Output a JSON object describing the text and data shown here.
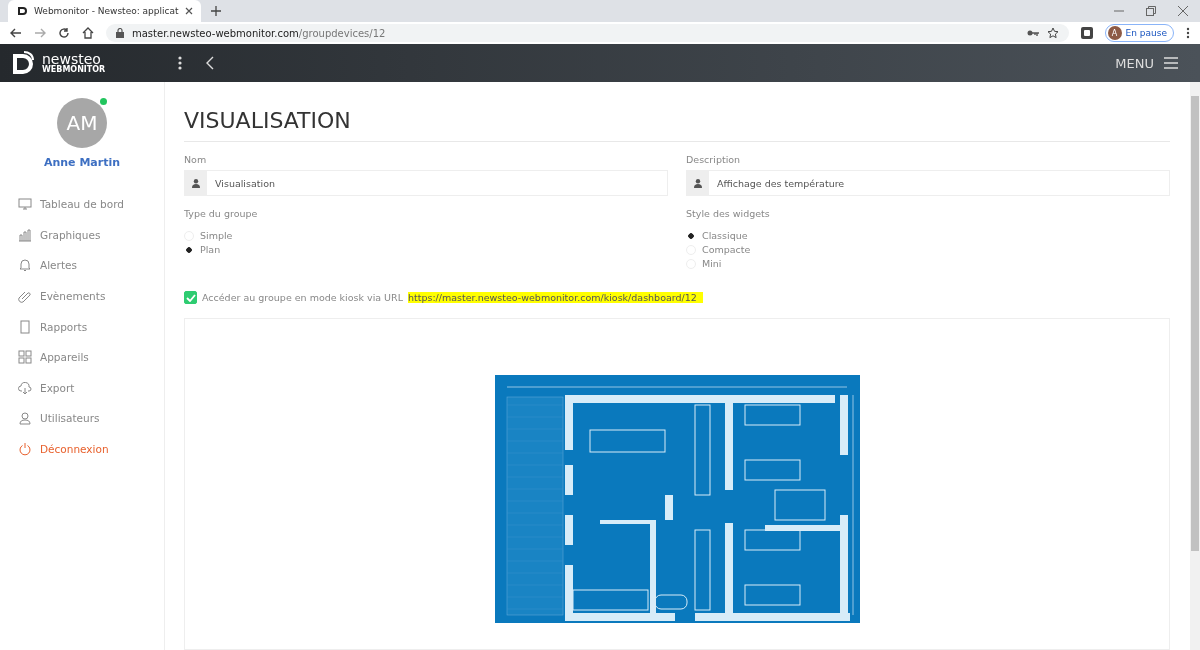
{
  "browser": {
    "tab_title": "Webmonitor - Newsteo: applicat",
    "address_host": "master.newsteo-webmonitor.com",
    "address_path": "/groupdevices/12",
    "profile_initial": "A",
    "profile_status": "En pause"
  },
  "header": {
    "logo_name": "newsteo",
    "logo_sub": "WEBMONITOR",
    "menu_label": "MENU"
  },
  "user": {
    "initials": "AM",
    "name": "Anne Martin",
    "online": true
  },
  "nav": [
    {
      "label": "Tableau de bord",
      "kind": "link"
    },
    {
      "label": "Graphiques",
      "kind": "link"
    },
    {
      "label": "Alertes",
      "kind": "link"
    },
    {
      "label": "Evènements",
      "kind": "link"
    },
    {
      "label": "Rapports",
      "kind": "link"
    },
    {
      "label": "Appareils",
      "kind": "link"
    },
    {
      "label": "Export",
      "kind": "link"
    },
    {
      "label": "Utilisateurs",
      "kind": "link"
    },
    {
      "label": "Déconnexion",
      "kind": "logout"
    }
  ],
  "page": {
    "title": "VISUALISATION",
    "fields": [
      {
        "label": "Nom",
        "value": "Visualisation"
      },
      {
        "label": "Description",
        "value": "Affichage des température"
      }
    ],
    "groups": [
      {
        "label": "Type du groupe",
        "options": [
          {
            "label": "Simple",
            "selected": false
          },
          {
            "label": "Plan",
            "selected": true
          }
        ]
      },
      {
        "label": "Style des widgets",
        "options": [
          {
            "label": "Classique",
            "selected": true
          },
          {
            "label": "Compacte",
            "selected": false
          },
          {
            "label": "Mini",
            "selected": false
          }
        ]
      }
    ],
    "kiosk": {
      "checked": true,
      "label": "Accéder au groupe en mode kiosk via URL",
      "url": "https://master.newsteo-webmonitor.com/kiosk/dashboard/12"
    }
  }
}
